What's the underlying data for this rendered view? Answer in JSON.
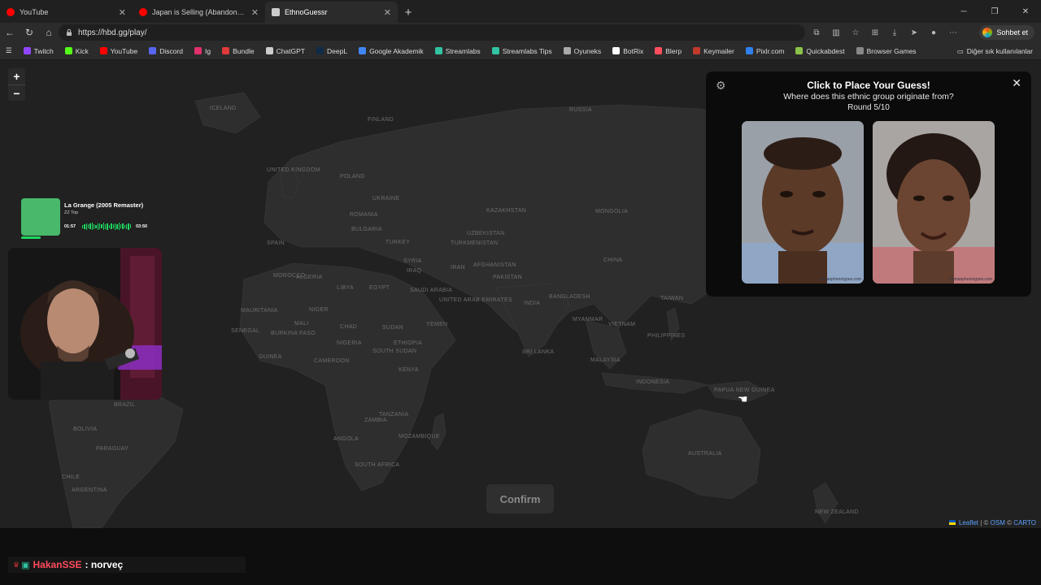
{
  "browser": {
    "tabs": [
      {
        "title": "YouTube",
        "favicon_color": "#ff0000"
      },
      {
        "title": "Japan is Selling (Abandoned) Hou",
        "favicon_color": "#ff0000"
      },
      {
        "title": "EthnoGuessr",
        "favicon_color": "#cccccc"
      }
    ],
    "url": "https://hbd.gg/play/",
    "copilot_label": "Sohbet et",
    "bookmarks": [
      {
        "label": "Twitch",
        "color": "#9146ff"
      },
      {
        "label": "Kick",
        "color": "#53fc18"
      },
      {
        "label": "YouTube",
        "color": "#ff0000"
      },
      {
        "label": "Discord",
        "color": "#5865f2"
      },
      {
        "label": "Ig",
        "color": "#e1306c"
      },
      {
        "label": "Bundle",
        "color": "#e03a3a"
      },
      {
        "label": "ChatGPT",
        "color": "#cccccc"
      },
      {
        "label": "DeepL",
        "color": "#0f2b46"
      },
      {
        "label": "Google Akademik",
        "color": "#4285f4"
      },
      {
        "label": "Streamlabs",
        "color": "#31c3a2"
      },
      {
        "label": "Streamlabs Tips",
        "color": "#31c3a2"
      },
      {
        "label": "Oyuneks",
        "color": "#aaaaaa"
      },
      {
        "label": "BotRix",
        "color": "#ffffff"
      },
      {
        "label": "Blerp",
        "color": "#ff4f5e"
      },
      {
        "label": "Keymailer",
        "color": "#c0392b"
      },
      {
        "label": "Pixlr.com",
        "color": "#2f80ed"
      },
      {
        "label": "Quickabdest",
        "color": "#8bc34a"
      },
      {
        "label": "Browser Games",
        "color": "#888888"
      }
    ],
    "bookmarks_other": "Diğer sık kullanılanlar"
  },
  "map": {
    "zoom_in": "+",
    "zoom_out": "−",
    "labels": [
      "RUSSIA",
      "FINLAND",
      "ICELAND",
      "UNITED KINGDOM",
      "POLAND",
      "UKRAINE",
      "KAZAKHSTAN",
      "MONGOLIA",
      "SPAIN",
      "ROMANIA",
      "BULGARIA",
      "TURKEY",
      "UZBEKISTAN",
      "TURKMENISTAN",
      "CHINA",
      "SYRIA",
      "IRAQ",
      "IRAN",
      "AFGHANISTAN",
      "PAKISTAN",
      "MOROCCO",
      "ALGERIA",
      "LIBYA",
      "EGYPT",
      "SAUDI ARABIA",
      "UNITED ARAB EMIRATES",
      "INDIA",
      "BANGLADESH",
      "MYANMAR",
      "TAIWAN",
      "MAURITANIA",
      "MALI",
      "NIGER",
      "CHAD",
      "SUDAN",
      "YEMEN",
      "VIETNAM",
      "PHILIPPINES",
      "SENEGAL",
      "BURKINA FASO",
      "NIGERIA",
      "ETHIOPIA",
      "SOUTH SUDAN",
      "SRI LANKA",
      "GUINEA",
      "MALAYSIA",
      "CAMEROON",
      "KENYA",
      "INDONESIA",
      "PAPUA NEW GUINEA",
      "BRAZIL",
      "TANZANIA",
      "ZAMBIA",
      "BOLIVIA",
      "PARAGUAY",
      "MOZAMBIQUE",
      "ANGOLA",
      "CHILE",
      "ARGENTINA",
      "SOUTH AFRICA",
      "AUSTRALIA",
      "NEW ZEALAND"
    ],
    "attribution": {
      "leaflet": "Leaflet",
      "sep": "| ©",
      "osm": "OSM",
      "copy": "©",
      "carto": "CARTO"
    },
    "confirm_label": "Confirm"
  },
  "panel": {
    "title": "Click to Place Your Guess!",
    "subtitle": "Where does this ethnic group originate from?",
    "round": "Round 5/10",
    "watermarks": [
      "humanphenotypes.com",
      "humanphenotypes.com"
    ]
  },
  "music": {
    "song": "La Grange (2005 Remaster)",
    "artist": "ZZ Top",
    "current": "01:57",
    "total": "03:50",
    "progress_fraction": 0.51
  },
  "chat": {
    "user": "HakanSSE",
    "message": ": norveç"
  }
}
